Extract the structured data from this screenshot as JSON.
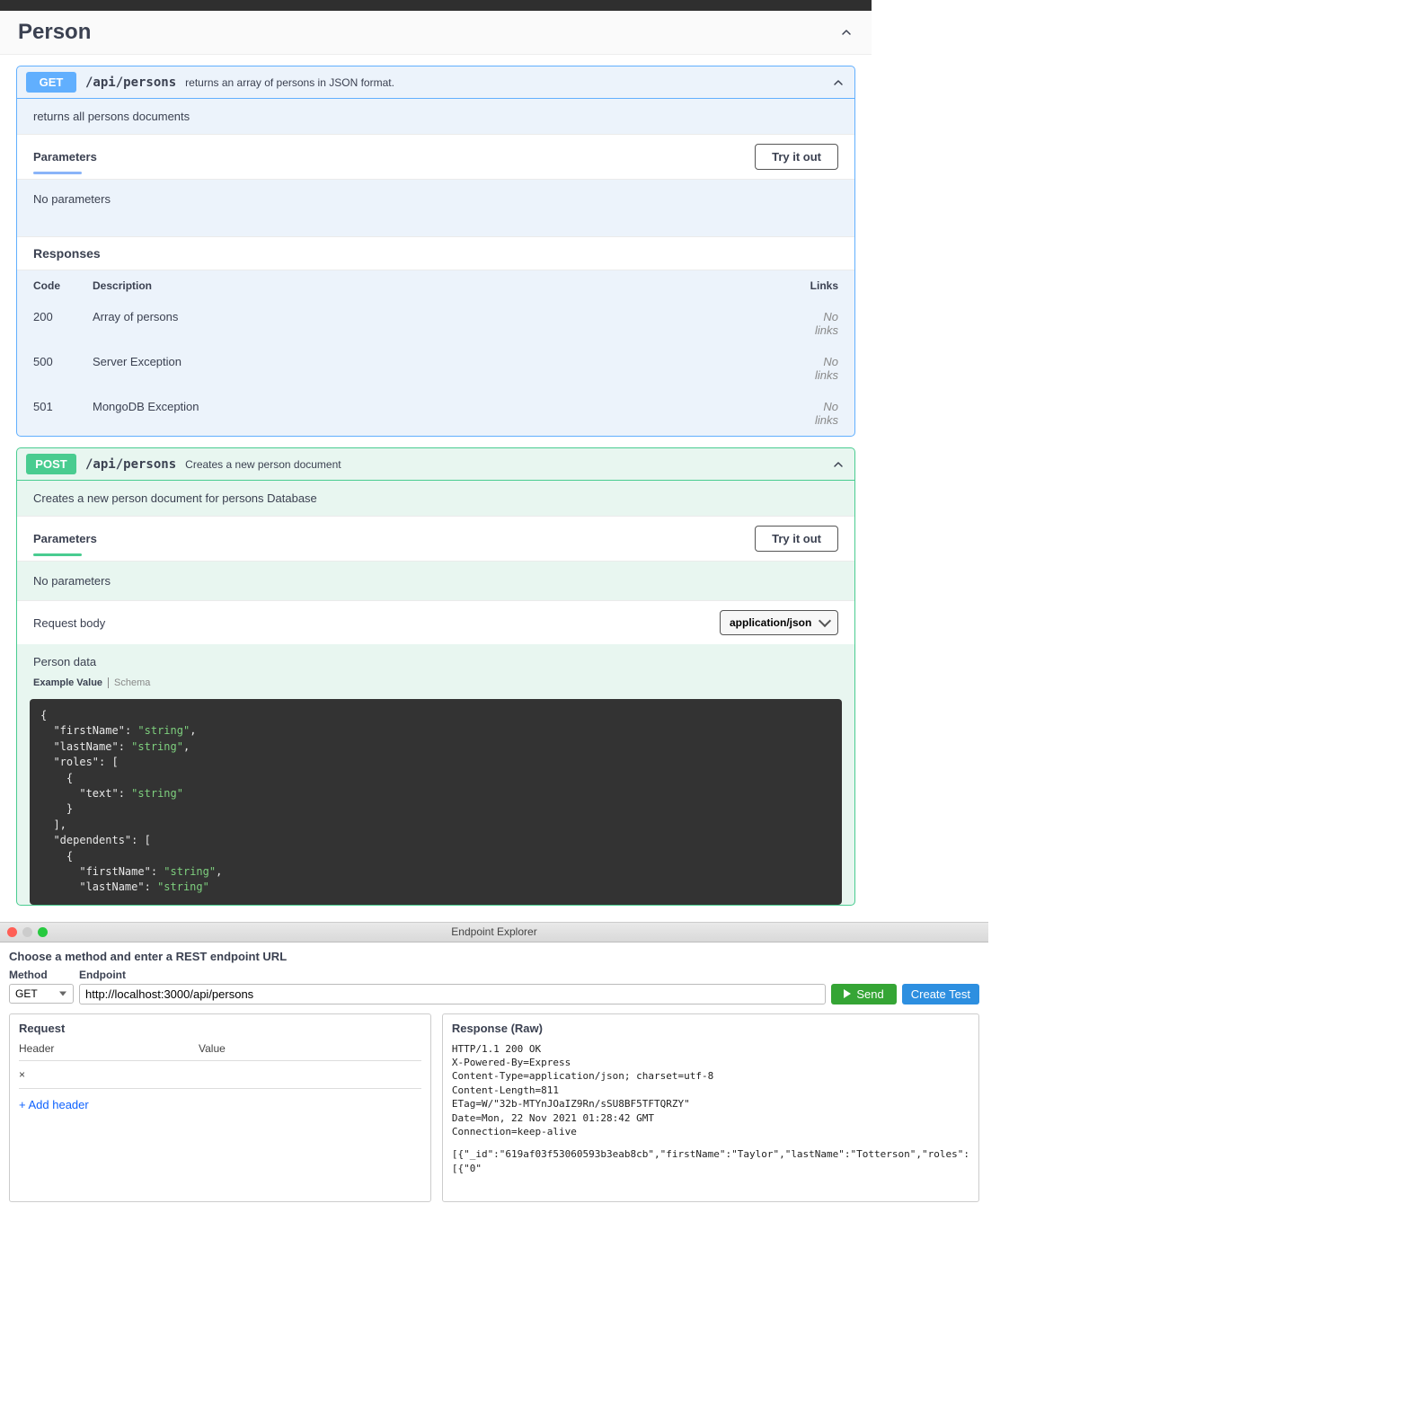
{
  "tag": {
    "name": "Person"
  },
  "ops": {
    "get": {
      "method": "GET",
      "path": "/api/persons",
      "summary": "returns an array of persons in JSON format.",
      "description": "returns all persons documents",
      "parameters_header": "Parameters",
      "try_label": "Try it out",
      "no_params": "No parameters",
      "responses_header": "Responses",
      "columns": {
        "code": "Code",
        "desc": "Description",
        "links": "Links"
      },
      "responses": [
        {
          "code": "200",
          "desc": "Array of persons",
          "links": "No links"
        },
        {
          "code": "500",
          "desc": "Server Exception",
          "links": "No links"
        },
        {
          "code": "501",
          "desc": "MongoDB Exception",
          "links": "No links"
        }
      ]
    },
    "post": {
      "method": "POST",
      "path": "/api/persons",
      "summary": "Creates a new person document",
      "description": "Creates a new person document for persons Database",
      "parameters_header": "Parameters",
      "try_label": "Try it out",
      "no_params": "No parameters",
      "request_body_label": "Request body",
      "content_type": "application/json",
      "body_desc": "Person data",
      "example_tab": "Example Value",
      "schema_tab": "Schema"
    }
  },
  "code_example": {
    "l1a": "\"firstName\"",
    "l1b": "\"string\"",
    "l2a": "\"lastName\"",
    "l2b": "\"string\"",
    "l3a": "\"roles\"",
    "l4a": "\"text\"",
    "l4b": "\"string\"",
    "l5a": "\"dependents\"",
    "l6a": "\"firstName\"",
    "l6b": "\"string\"",
    "l7a": "\"lastName\"",
    "l7b": "\"string\""
  },
  "explorer": {
    "title": "Endpoint Explorer",
    "hint": "Choose a method and enter a REST endpoint URL",
    "method_label": "Method",
    "endpoint_label": "Endpoint",
    "method": "GET",
    "endpoint": "http://localhost:3000/api/persons",
    "send_label": "Send",
    "create_test_label": "Create Test",
    "request": {
      "title": "Request",
      "header_col": "Header",
      "value_col": "Value",
      "close_x": "×",
      "add_header": "+ Add header"
    },
    "response": {
      "title": "Response (Raw)",
      "headers": "HTTP/1.1 200 OK\nX-Powered-By=Express\nContent-Type=application/json; charset=utf-8\nContent-Length=811\nETag=W/\"32b-MTYnJOaIZ9Rn/sSU8BF5TFTQRZY\"\nDate=Mon, 22 Nov 2021 01:28:42 GMT\nConnection=keep-alive",
      "body": "[{\"_id\":\"619af03f53060593b3eab8cb\",\"firstName\":\"Taylor\",\"lastName\":\"Totterson\",\"roles\":[{\"0\""
    }
  }
}
